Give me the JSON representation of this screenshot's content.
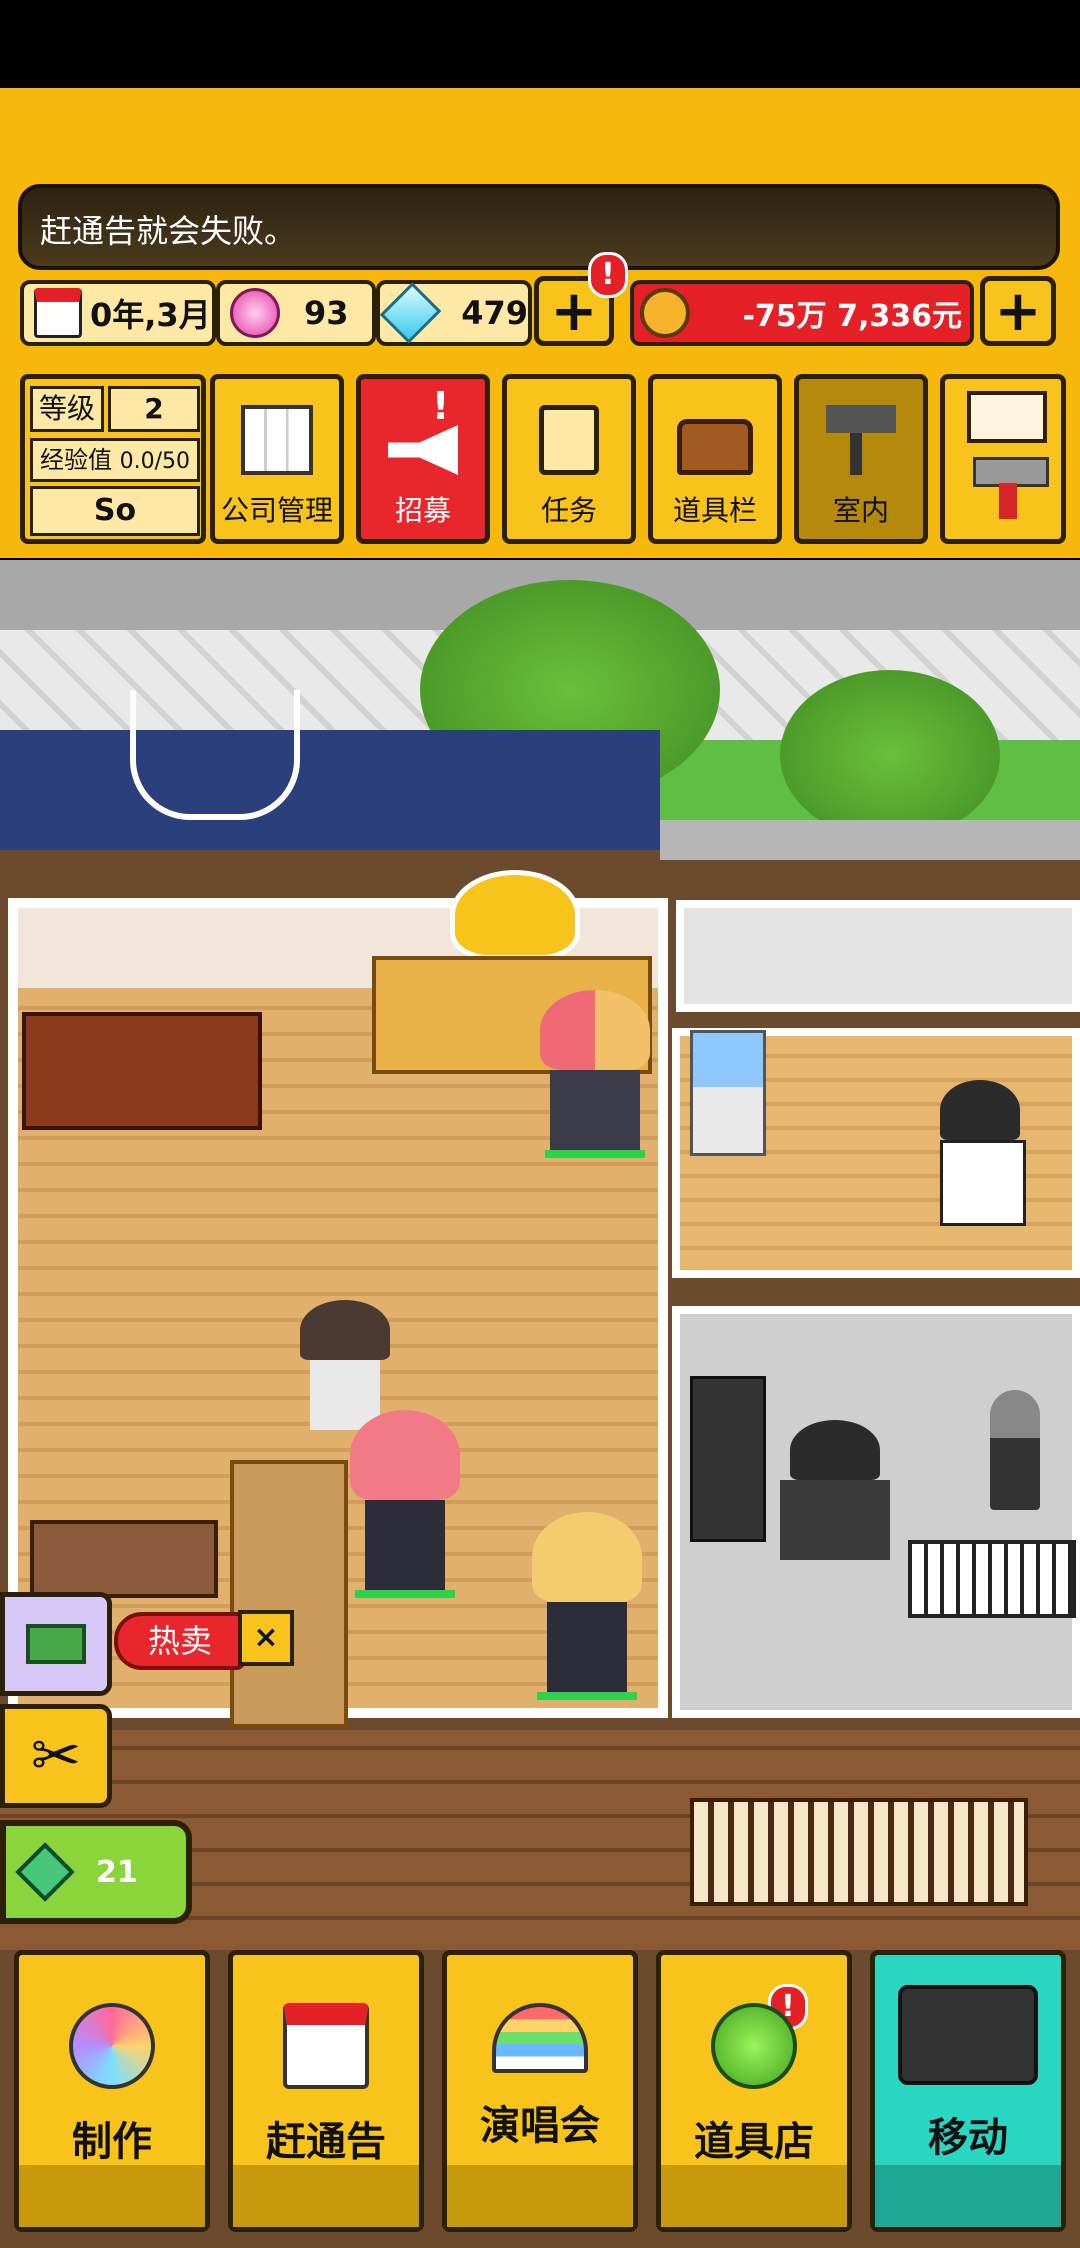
{
  "tip": "赶通告就会失败。",
  "stats": {
    "date": "0年,3月",
    "pink_gems": "93",
    "blue_gems": "479",
    "money": "-75万 7,336元",
    "alert_badge": "!"
  },
  "profile": {
    "level_label": "等级",
    "level_value": "2",
    "exp_label": "经验值",
    "exp_value": "0.0/50",
    "name": "So"
  },
  "menu": [
    {
      "label": "公司管理",
      "icon": "building-icon"
    },
    {
      "label": "招募",
      "icon": "megaphone-icon",
      "badge": "!"
    },
    {
      "label": "任务",
      "icon": "scroll-icon"
    },
    {
      "label": "道具栏",
      "icon": "chest-icon"
    },
    {
      "label": "室内",
      "icon": "paint-roller-icon"
    },
    {
      "label": "",
      "icon": "mail-icon"
    }
  ],
  "side": {
    "hot_sale_label": "热卖",
    "diamond_count": "21"
  },
  "bottom_nav": [
    {
      "label": "制作",
      "icon": "disc-icon"
    },
    {
      "label": "赶通告",
      "icon": "calendar-icon"
    },
    {
      "label": "演唱会",
      "icon": "rainbow-stage-icon"
    },
    {
      "label": "道具店",
      "icon": "clover-icon",
      "badge": "!"
    },
    {
      "label": "移动",
      "icon": "truck-icon"
    }
  ],
  "colors": {
    "header_yellow": "#f7b80c",
    "button_yellow": "#f8c31a",
    "recruit_red": "#e8262b",
    "money_red": "#e52027",
    "move_teal": "#29d6c2",
    "diamond_green": "#7ac62a"
  }
}
